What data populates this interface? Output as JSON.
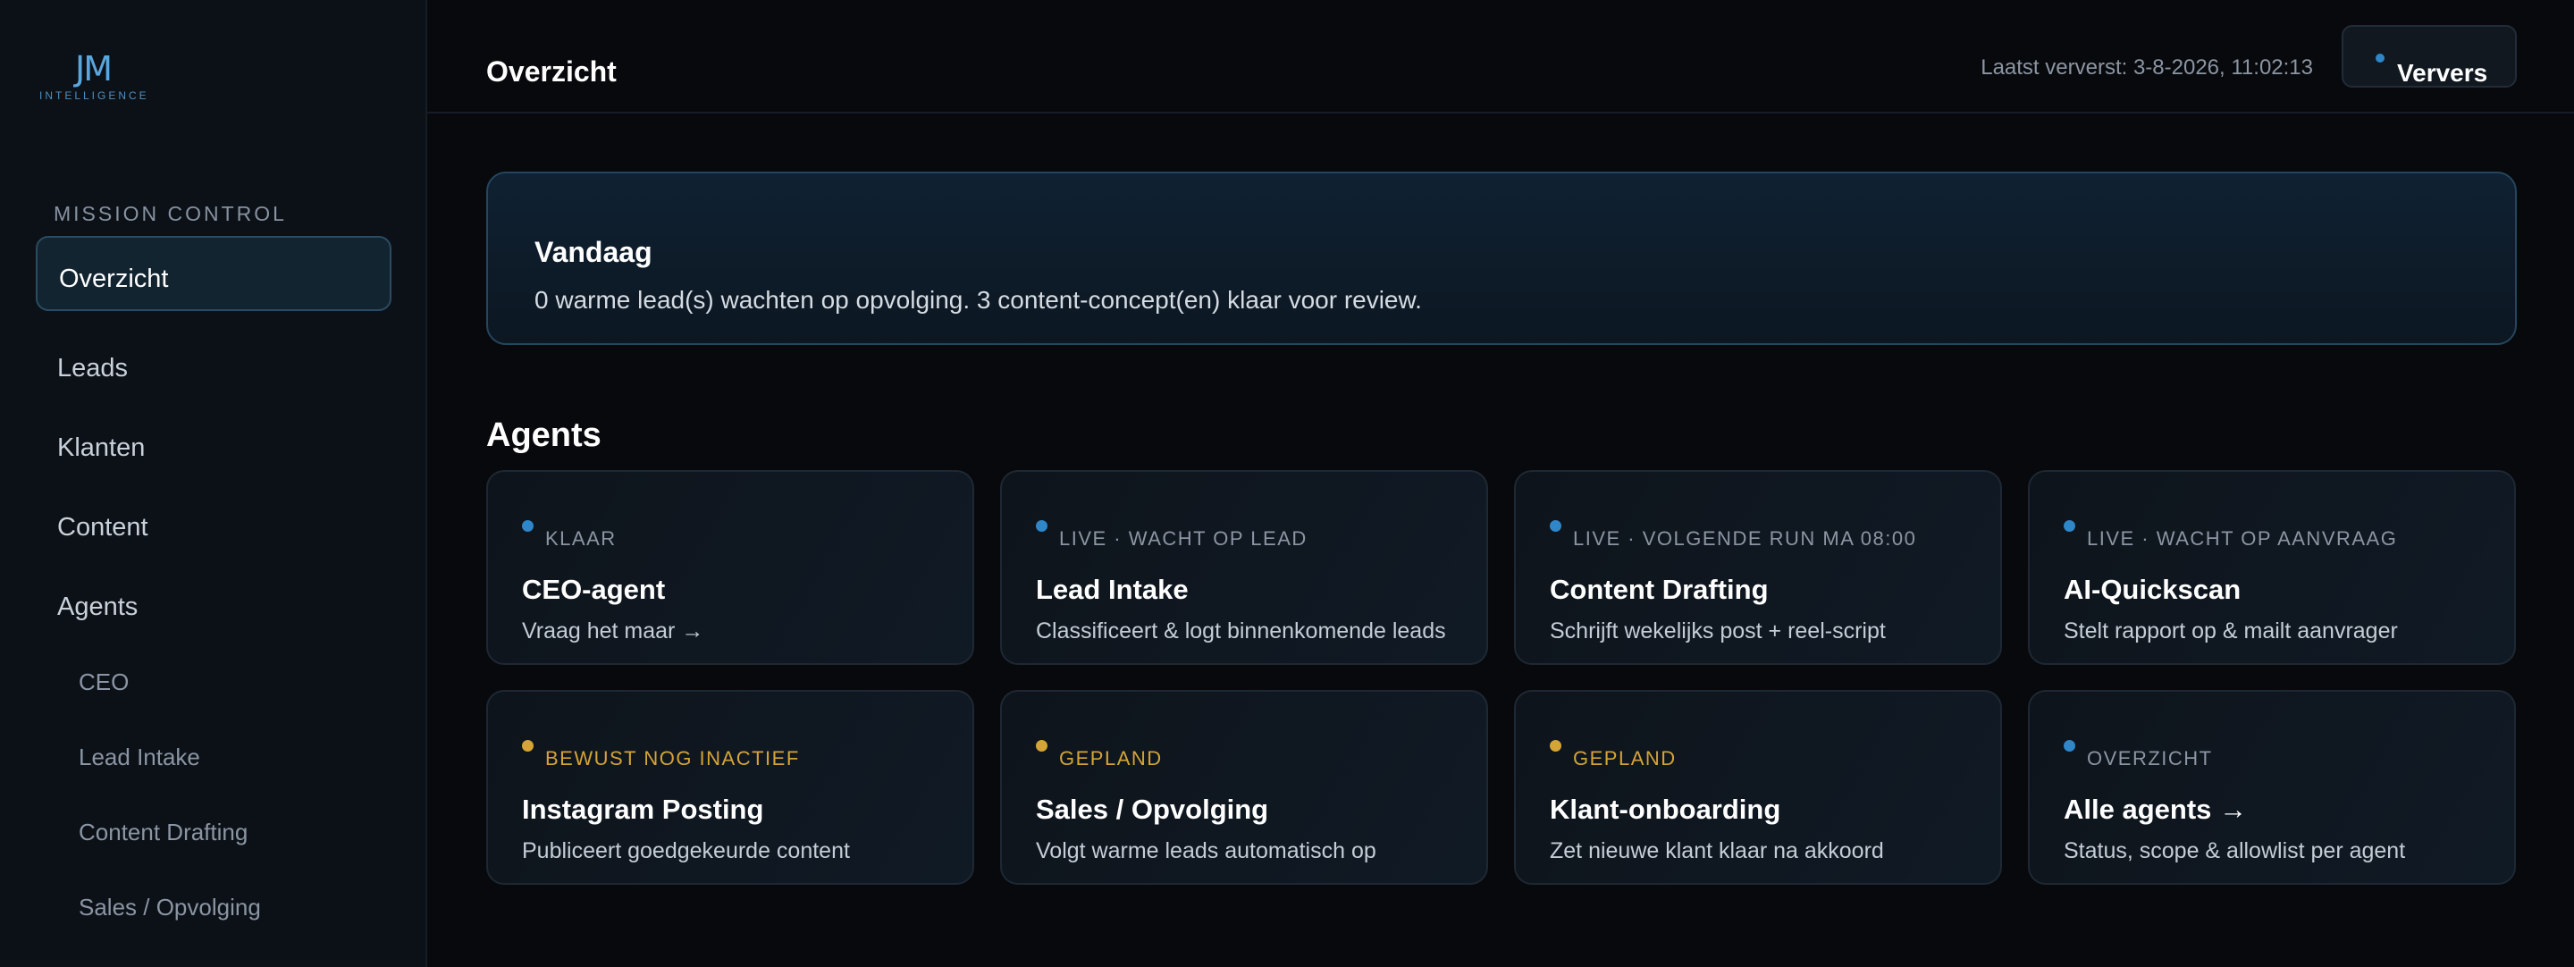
{
  "brand": {
    "mark": "JM",
    "sub": "INTELLIGENCE"
  },
  "sidebar": {
    "section": "MISSION CONTROL",
    "items": [
      "Overzicht",
      "Leads",
      "Klanten",
      "Content",
      "Agents"
    ],
    "subitems": [
      "CEO",
      "Lead Intake",
      "Content Drafting",
      "Sales / Opvolging"
    ]
  },
  "header": {
    "title": "Overzicht",
    "refreshed": "Laatst ververst: 3-8-2026, 11:02:13",
    "refresh_label": "Ververs"
  },
  "today": {
    "title": "Vandaag",
    "text": "0 warme lead(s) wachten op opvolging. 3 content-concept(en) klaar voor review."
  },
  "agents": {
    "heading": "Agents",
    "cards": [
      {
        "status": "KLAAR",
        "title": "CEO-agent",
        "desc": "Vraag het maar →",
        "color": "#2f86c8"
      },
      {
        "status": "LIVE · WACHT OP LEAD",
        "title": "Lead Intake",
        "desc": "Classificeert & logt binnenkomende leads",
        "color": "#2f86c8"
      },
      {
        "status": "LIVE · VOLGENDE RUN MA 08:00",
        "title": "Content Drafting",
        "desc": "Schrijft wekelijks post + reel-script",
        "color": "#2f86c8"
      },
      {
        "status": "LIVE · WACHT OP AANVRAAG",
        "title": "AI-Quickscan",
        "desc": "Stelt rapport op & mailt aanvrager",
        "color": "#2f86c8"
      },
      {
        "status": "BEWUST NOG INACTIEF",
        "title": "Instagram Posting",
        "desc": "Publiceert goedgekeurde content",
        "color": "#d4a437"
      },
      {
        "status": "GEPLAND",
        "title": "Sales / Opvolging",
        "desc": "Volgt warme leads automatisch op",
        "color": "#d4a437"
      },
      {
        "status": "GEPLAND",
        "title": "Klant-onboarding",
        "desc": "Zet nieuwe klant klaar na akkoord",
        "color": "#d4a437"
      },
      {
        "status": "OVERZICHT",
        "title": "Alle agents →",
        "desc": "Status, scope & allowlist per agent",
        "color": "#2f86c8"
      }
    ]
  },
  "colors": {
    "accent": "#2f86c8",
    "warning": "#d4a437",
    "muted_status": "#8b95a3"
  }
}
